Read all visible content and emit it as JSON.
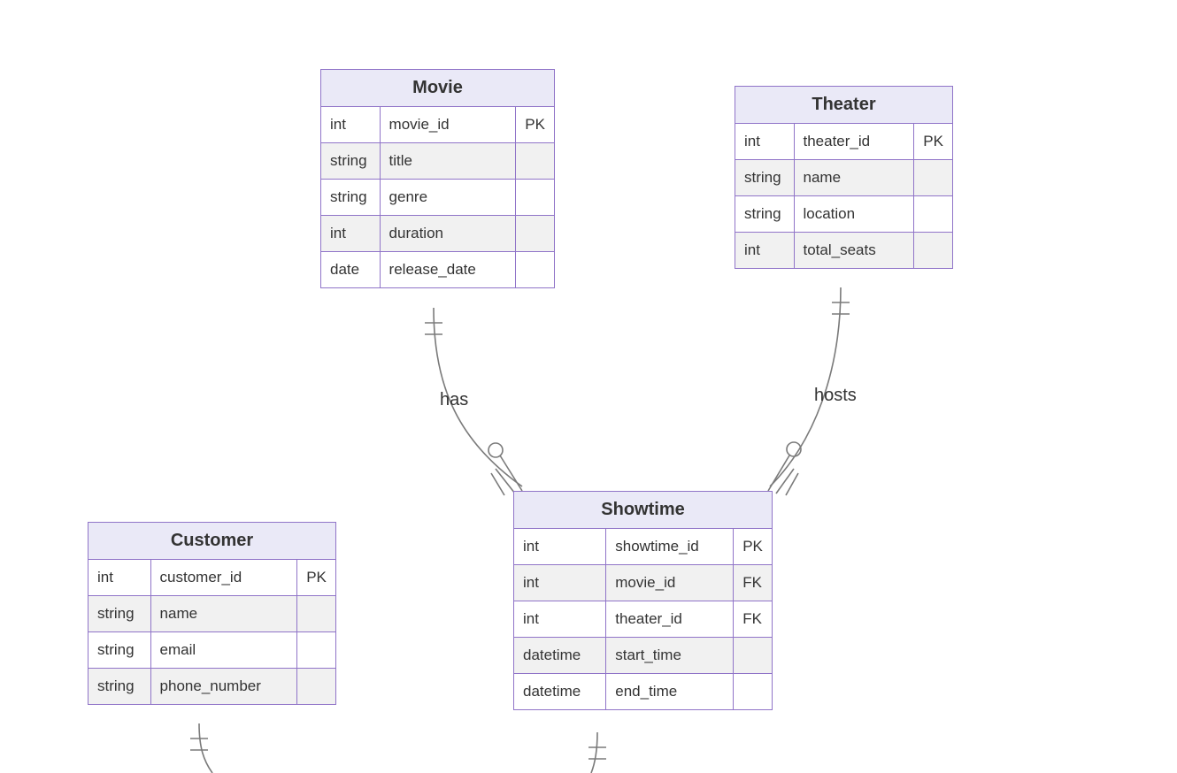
{
  "entities": {
    "movie": {
      "title": "Movie",
      "rows": [
        {
          "type": "int",
          "name": "movie_id",
          "key": "PK"
        },
        {
          "type": "string",
          "name": "title",
          "key": ""
        },
        {
          "type": "string",
          "name": "genre",
          "key": ""
        },
        {
          "type": "int",
          "name": "duration",
          "key": ""
        },
        {
          "type": "date",
          "name": "release_date",
          "key": ""
        }
      ]
    },
    "theater": {
      "title": "Theater",
      "rows": [
        {
          "type": "int",
          "name": "theater_id",
          "key": "PK"
        },
        {
          "type": "string",
          "name": "name",
          "key": ""
        },
        {
          "type": "string",
          "name": "location",
          "key": ""
        },
        {
          "type": "int",
          "name": "total_seats",
          "key": ""
        }
      ]
    },
    "customer": {
      "title": "Customer",
      "rows": [
        {
          "type": "int",
          "name": "customer_id",
          "key": "PK"
        },
        {
          "type": "string",
          "name": "name",
          "key": ""
        },
        {
          "type": "string",
          "name": "email",
          "key": ""
        },
        {
          "type": "string",
          "name": "phone_number",
          "key": ""
        }
      ]
    },
    "showtime": {
      "title": "Showtime",
      "rows": [
        {
          "type": "int",
          "name": "showtime_id",
          "key": "PK"
        },
        {
          "type": "int",
          "name": "movie_id",
          "key": "FK"
        },
        {
          "type": "int",
          "name": "theater_id",
          "key": "FK"
        },
        {
          "type": "datetime",
          "name": "start_time",
          "key": ""
        },
        {
          "type": "datetime",
          "name": "end_time",
          "key": ""
        }
      ]
    }
  },
  "relationships": {
    "movie_showtime": {
      "label": "has"
    },
    "theater_showtime": {
      "label": "hosts"
    },
    "customer_down": {
      "label": ""
    },
    "showtime_down": {
      "label": ""
    }
  },
  "colors": {
    "border": "#9074c8",
    "header_bg": "#eae9f7",
    "row_alt_bg": "#f1f1f1",
    "line": "#7a7a7a"
  }
}
